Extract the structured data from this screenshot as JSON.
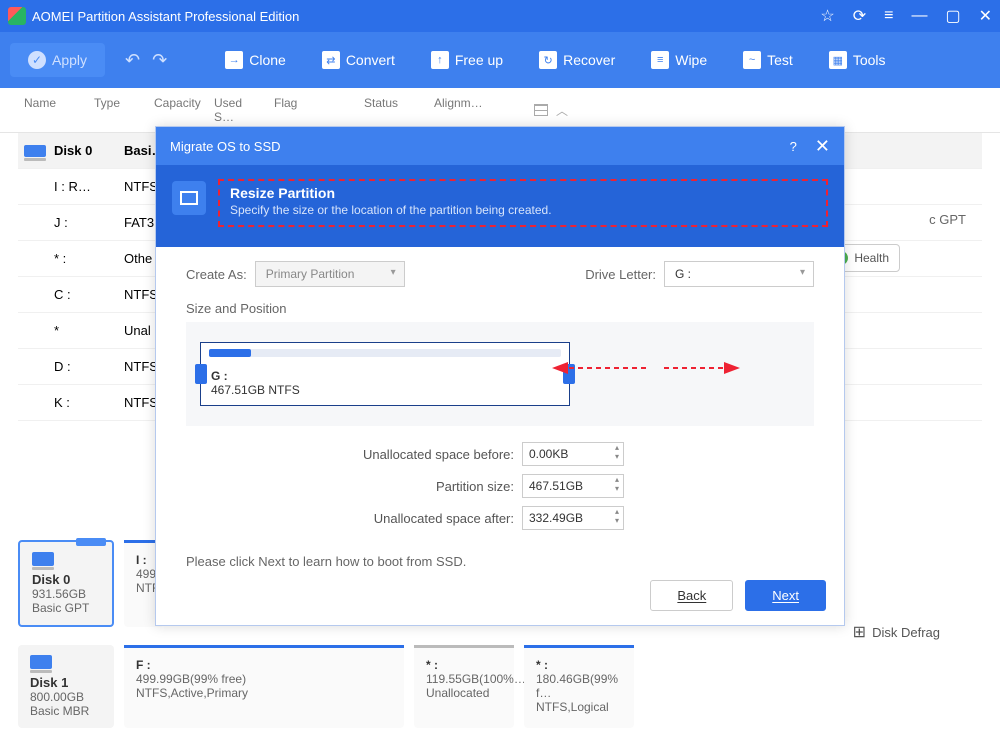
{
  "window": {
    "title": "AOMEI Partition Assistant Professional Edition"
  },
  "titlebar_icons": {
    "star": "☆",
    "refresh": "⟳",
    "menu": "≡",
    "min": "—",
    "max": "▢",
    "close": "✕"
  },
  "toolbar": {
    "apply": "Apply",
    "undo": "↶",
    "redo": "↷",
    "items": [
      {
        "label": "Clone"
      },
      {
        "label": "Convert"
      },
      {
        "label": "Free up"
      },
      {
        "label": "Recover"
      },
      {
        "label": "Wipe"
      },
      {
        "label": "Test"
      },
      {
        "label": "Tools"
      }
    ]
  },
  "columns": {
    "name": "Name",
    "type": "Type",
    "capacity": "Capacity",
    "used": "Used S…",
    "flag": "Flag",
    "status": "Status",
    "align": "Alignm…"
  },
  "rows": [
    {
      "kind": "disk",
      "name": "Disk 0",
      "type": "Basi…"
    },
    {
      "kind": "part",
      "name": "I : R…",
      "type": "NTFS"
    },
    {
      "kind": "part",
      "name": "J :",
      "type": "FAT3"
    },
    {
      "kind": "part",
      "name": "* :",
      "type": "Othe"
    },
    {
      "kind": "part",
      "name": "C :",
      "type": "NTFS"
    },
    {
      "kind": "part",
      "name": "*",
      "type": "Unal"
    },
    {
      "kind": "part",
      "name": "D :",
      "type": "NTFS"
    },
    {
      "kind": "part",
      "name": "K :",
      "type": "NTFS"
    }
  ],
  "right": {
    "gpt": "c GPT",
    "health": "Health"
  },
  "diskcards": {
    "d0": {
      "name": "Disk 0",
      "size": "931.56GB",
      "scheme": "Basic GPT"
    },
    "d0p": {
      "name": "I :",
      "size": "499",
      "fs": "NTF"
    },
    "d1": {
      "name": "Disk 1",
      "size": "800.00GB",
      "scheme": "Basic MBR"
    },
    "d1p1": {
      "name": "F :",
      "size": "499.99GB(99% free)",
      "fs": "NTFS,Active,Primary"
    },
    "d1p2": {
      "name": "* :",
      "size": "119.55GB(100%…",
      "fs": "Unallocated"
    },
    "d1p3": {
      "name": "* :",
      "size": "180.46GB(99% f…",
      "fs": "NTFS,Logical"
    }
  },
  "side": {
    "defrag": "Disk Defrag"
  },
  "modal": {
    "title": "Migrate OS to SSD",
    "head": {
      "title": "Resize Partition",
      "sub": "Specify the size or the location of the partition being created."
    },
    "create_as_label": "Create As:",
    "create_as_value": "Primary Partition",
    "drive_letter_label": "Drive Letter:",
    "drive_letter_value": "G :",
    "sizepos": "Size and Position",
    "slider": {
      "name": "G :",
      "detail": "467.51GB NTFS"
    },
    "fields": {
      "before_label": "Unallocated space before:",
      "before_value": "0.00KB",
      "size_label": "Partition size:",
      "size_value": "467.51GB",
      "after_label": "Unallocated space after:",
      "after_value": "332.49GB"
    },
    "hint": "Please click Next to learn how to boot from SSD.",
    "back": "Back",
    "next": "Next",
    "help": "?"
  }
}
